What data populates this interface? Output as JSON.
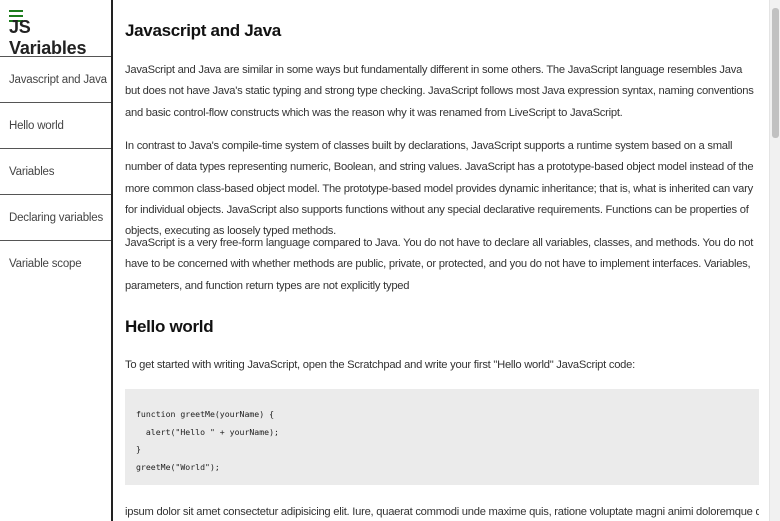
{
  "sidebar": {
    "title": "JS Variables",
    "menu_icon": "hamburger-icon",
    "items": [
      {
        "label": "Javascript and Java"
      },
      {
        "label": "Hello world"
      },
      {
        "label": "Variables"
      },
      {
        "label": "Declaring variables"
      },
      {
        "label": "Variable scope"
      }
    ]
  },
  "main": {
    "sections": [
      {
        "title": "Javascript and Java",
        "paragraphs": [
          "JavaScript and Java are similar in some ways but fundamentally different in some others. The JavaScript language resembles Java but does not have Java's static typing and strong type checking. JavaScript follows most Java expression syntax, naming conventions and basic control-flow constructs which was the reason why it was renamed from LiveScript to JavaScript.",
          "In contrast to Java's compile-time system of classes built by declarations, JavaScript supports a runtime system based on a small number of data types representing numeric, Boolean, and string values. JavaScript has a prototype-based object model instead of the more common class-based object model. The prototype-based model provides dynamic inheritance; that is, what is inherited can vary for individual objects. JavaScript also supports functions without any special declarative requirements. Functions can be properties of objects, executing as loosely typed methods.",
          "JavaScript is a very free-form language compared to Java. You do not have to declare all variables, classes, and methods. You do not have to be concerned with whether methods are public, private, or protected, and you do not have to implement interfaces. Variables, parameters, and function return types are not explicitly typed"
        ]
      },
      {
        "title": "Hello world",
        "intro": "To get started with writing JavaScript, open the Scratchpad and write your first \"Hello world\" JavaScript code:",
        "code": "function greetMe(yourName) {\n  alert(\"Hello \" + yourName);\n}\ngreetMe(\"World\");",
        "trailing": "ipsum dolor sit amet consectetur adipisicing elit. Iure, quaerat commodi unde maxime quis, ratione voluptate magni animi doloremque deleniti, molestias"
      }
    ]
  },
  "scrollbar": {
    "position": 0.02
  }
}
